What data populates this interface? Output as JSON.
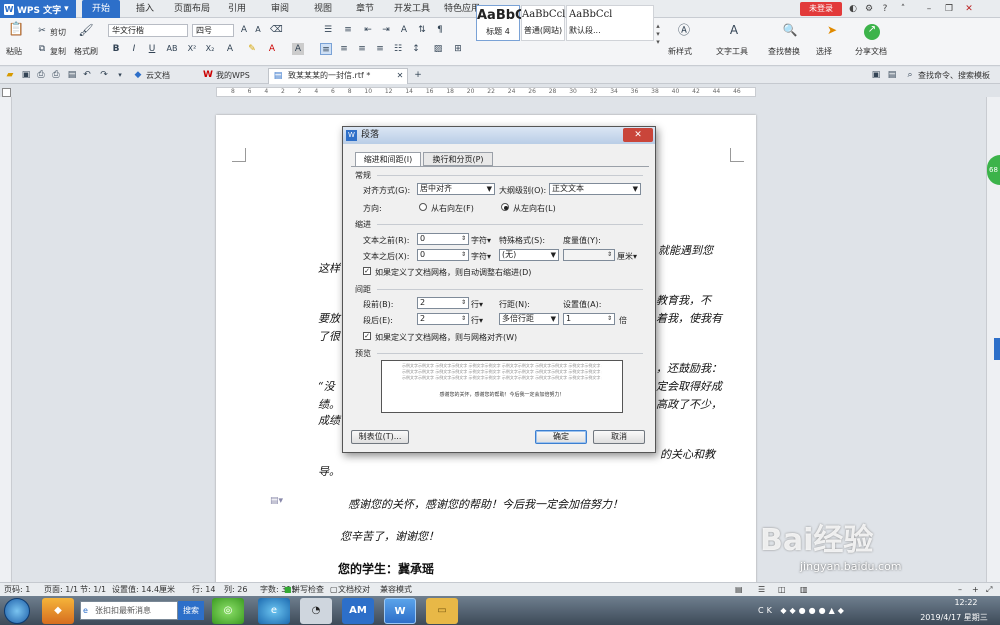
{
  "app": {
    "title": "WPS 文字"
  },
  "menu": {
    "tabs": [
      "开始",
      "插入",
      "页面布局",
      "引用",
      "审阅",
      "视图",
      "章节",
      "开发工具",
      "特色应用"
    ],
    "login_label": "未登录"
  },
  "ribbon": {
    "paste": "粘贴",
    "cut": "剪切",
    "copy": "复制",
    "format_painter": "格式刷",
    "font_name": "华文行楷",
    "font_size": "四号",
    "styles": [
      {
        "preview": "AaBbC",
        "name": "标题 4"
      },
      {
        "preview": "AaBbCcl",
        "name": "普通(网站)"
      },
      {
        "preview": "AaBbCcl",
        "name": "默认段..."
      }
    ],
    "new_style": "新样式",
    "text_tools": "文字工具",
    "find_replace": "查找替换",
    "select": "选择",
    "share_doc": "分享文档"
  },
  "quickbar": {
    "tabs": [
      "云文档",
      "我的WPS",
      "致某某某的一封信.rtf *"
    ],
    "search_hint": "查找命令、搜索模板"
  },
  "ruler": {
    "ticks": [
      "8",
      "6",
      "4",
      "2",
      "2",
      "4",
      "6",
      "8",
      "10",
      "12",
      "14",
      "16",
      "18",
      "20",
      "22",
      "24",
      "26",
      "28",
      "30",
      "32",
      "34",
      "36",
      "38",
      "40",
      "42",
      "44",
      "46"
    ]
  },
  "document": {
    "lines": [
      {
        "text": "就能遇到您"
      },
      {
        "text": "这样"
      },
      {
        "text": "教育我，不"
      },
      {
        "text": "要放"
      },
      {
        "text": "着我，使我有"
      },
      {
        "text": "了很"
      },
      {
        "text": "，还鼓励我："
      },
      {
        "text": "“没"
      },
      {
        "text": "定会取得好成"
      },
      {
        "text": "绩。"
      },
      {
        "text": "高政了不少，"
      },
      {
        "text": "成绩"
      },
      {
        "text": "的关心和教"
      },
      {
        "text": "导。"
      },
      {
        "text": "感谢您的关怀，感谢您的帮助！今后我一定会加倍努力！"
      },
      {
        "text": "您辛苦了，谢谢您！"
      },
      {
        "text": "您的学生：冀承瑶"
      }
    ]
  },
  "dialog": {
    "title": "段落",
    "tab_indent": "缩进和间距(I)",
    "tab_breaks": "换行和分页(P)",
    "section_general": "常规",
    "align_label": "对齐方式(G):",
    "align_value": "居中对齐",
    "outline_label": "大纲级别(O):",
    "outline_value": "正文文本",
    "direction_label": "方向:",
    "dir_rtl": "从右向左(F)",
    "dir_ltr": "从左向右(L)",
    "section_indent": "缩进",
    "before_text_label": "文本之前(R):",
    "before_text_value": "0",
    "after_text_label": "文本之后(X):",
    "after_text_value": "0",
    "unit_char": "字符▾",
    "special_label": "特殊格式(S):",
    "special_value": "(无)",
    "measure_label": "度量值(Y):",
    "unit_cm": "厘米▾",
    "grid_indent_check": "如果定义了文档网格，则自动调整右缩进(D)",
    "section_spacing": "间距",
    "before_label": "段前(B):",
    "before_value": "2",
    "after_label": "段后(E):",
    "after_value": "2",
    "unit_line": "行▾",
    "line_spacing_label": "行距(N):",
    "line_spacing_value": "多倍行距",
    "setting_label": "设置值(A):",
    "setting_value": "1",
    "unit_times": "倍",
    "grid_align_check": "如果定义了文档网格，则与网格对齐(W)",
    "section_preview": "预览",
    "preview_text": "示例文字",
    "preview_sample": "感谢您的关怀，感谢您的帮助！今后我一定会加倍努力！",
    "tabs_button": "制表位(T)...",
    "ok_button": "确定",
    "cancel_button": "取消"
  },
  "status": {
    "page": "页码: 1",
    "pages": "页面: 1/1",
    "section": "节: 1/1",
    "setting": "设置值: 14.4厘米",
    "row": "行: 14",
    "col": "列: 26",
    "words": "字数: 315",
    "spellcheck": "拼写检查",
    "doc_check": "文档校对",
    "compat": "兼容模式"
  },
  "taskbar": {
    "search_placeholder": "张扣扣最新消息",
    "search_button": "搜索",
    "clock_time": "12:22",
    "clock_date": "2019/4/17 星期三"
  },
  "watermark": {
    "brand": "Bai经验",
    "url": "jingyan.baidu.com"
  }
}
